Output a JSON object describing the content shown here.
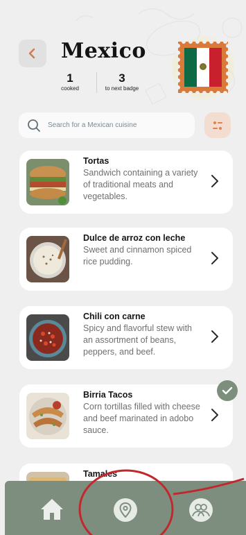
{
  "header": {
    "back_icon": "chevron-left-icon",
    "title": "Mexico",
    "stats": {
      "cooked": {
        "value": "1",
        "label": "cooked"
      },
      "to_next_badge": {
        "value": "3",
        "label": "to next badge"
      }
    },
    "flag_icon": "mexico-flag-stamp"
  },
  "search": {
    "placeholder": "Search for a Mexican cuisine",
    "icon": "search-icon",
    "filter_icon": "filter-sliders-icon"
  },
  "dishes": [
    {
      "name": "Tortas",
      "description": "Sandwich containing a variety of traditional meats and vegetables.",
      "cooked": false
    },
    {
      "name": "Dulce de arroz con leche",
      "description": "Sweet and cinnamon spiced rice pudding.",
      "cooked": false
    },
    {
      "name": "Chili con carne",
      "description": "Spicy and flavorful stew with an assortment of beans, peppers, and beef.",
      "cooked": false
    },
    {
      "name": "Birria Tacos",
      "description": "Corn tortillas filled with cheese and beef marinated in adobo sauce.",
      "cooked": true
    },
    {
      "name": "Tamales",
      "description": "",
      "cooked": false
    }
  ],
  "nav": {
    "items": [
      {
        "icon": "home-icon"
      },
      {
        "icon": "location-pin-icon",
        "active": true
      },
      {
        "icon": "community-people-icon"
      }
    ]
  },
  "colors": {
    "background": "#efefef",
    "accent": "#d07a4a",
    "nav": "#7e8e7e",
    "check": "#7b8f7c",
    "annotation": "#c0282d"
  }
}
